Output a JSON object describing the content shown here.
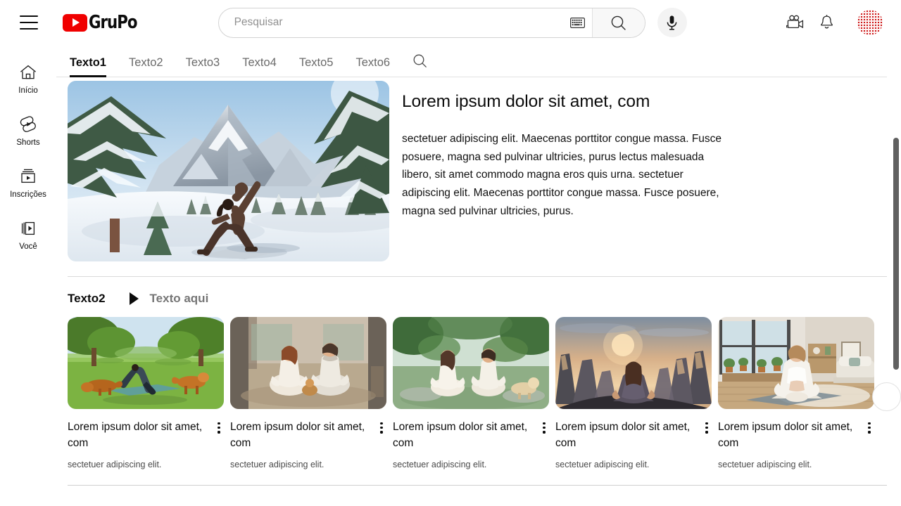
{
  "header": {
    "menu_icon": "hamburger-menu-icon",
    "logo_text": "GruPo",
    "logo_icon": "youtube-play-icon",
    "search": {
      "placeholder": "Pesquisar",
      "value": "",
      "keyboard_icon": "keyboard-icon",
      "submit_icon": "search-icon"
    },
    "mic_icon": "microphone-icon",
    "actions": [
      {
        "name": "create-video-icon",
        "glyph": "camera"
      },
      {
        "name": "notifications-icon",
        "glyph": "bell"
      }
    ],
    "avatar": {
      "name": "user-avatar",
      "color": "#cc1616"
    }
  },
  "sidebar": {
    "items": [
      {
        "label": "Início",
        "icon": "home-icon"
      },
      {
        "label": "Shorts",
        "icon": "shorts-icon"
      },
      {
        "label": "Inscrições",
        "icon": "subscriptions-icon"
      },
      {
        "label": "Você",
        "icon": "you-library-icon"
      }
    ]
  },
  "tabs": {
    "items": [
      {
        "label": "Texto1",
        "active": true
      },
      {
        "label": "Texto2",
        "active": false
      },
      {
        "label": "Texto3",
        "active": false
      },
      {
        "label": "Texto4",
        "active": false
      },
      {
        "label": "Texto5",
        "active": false
      },
      {
        "label": "Texto6",
        "active": false
      }
    ],
    "search_icon": "tab-search-icon"
  },
  "hero": {
    "image_alt": "person doing yoga in snowy mountain forest",
    "title": "Lorem ipsum dolor sit amet, com",
    "body": "sectetuer adipiscing  elit. Maecenas porttitor congue  massa. Fusce  posuere,  magna sed pulvinar  ultricies,  purus  lectus malesuada  libero,  sit amet commodo  magna eros quis  urna. sectetuer adipiscing  elit. Maecenas porttitor congue  massa. Fusce  posuere,  magna sed pulvinar  ultricies,  purus."
  },
  "section": {
    "title": "Texto2",
    "play_icon": "play-triangle-icon",
    "subtitle": "Texto aqui"
  },
  "cards": [
    {
      "title": "Lorem ipsum dolor sit amet, com",
      "subtitle": "sectetuer adipiscing  elit.",
      "image_alt": "yoga in a green park with dogs",
      "menu_icon": "more-options-icon"
    },
    {
      "title": "Lorem ipsum dolor sit amet, com",
      "subtitle": "sectetuer adipiscing  elit.",
      "image_alt": "two people meditating on a porch",
      "menu_icon": "more-options-icon"
    },
    {
      "title": "Lorem ipsum dolor sit amet, com",
      "subtitle": "sectetuer adipiscing  elit.",
      "image_alt": "couple meditating in jungle with dog",
      "menu_icon": "more-options-icon"
    },
    {
      "title": "Lorem ipsum dolor sit amet, com",
      "subtitle": "sectetuer adipiscing  elit.",
      "image_alt": "woman meditating on mountain at sunset",
      "menu_icon": "more-options-icon"
    },
    {
      "title": "Lorem ipsum dolor sit amet, com",
      "subtitle": "sectetuer adipiscing  elit.",
      "image_alt": "woman meditating indoors in bright living room",
      "menu_icon": "more-options-icon"
    }
  ],
  "carousel": {
    "next_icon": "chevron-right-icon"
  },
  "scrollbar": {
    "name": "page-scrollbar"
  }
}
